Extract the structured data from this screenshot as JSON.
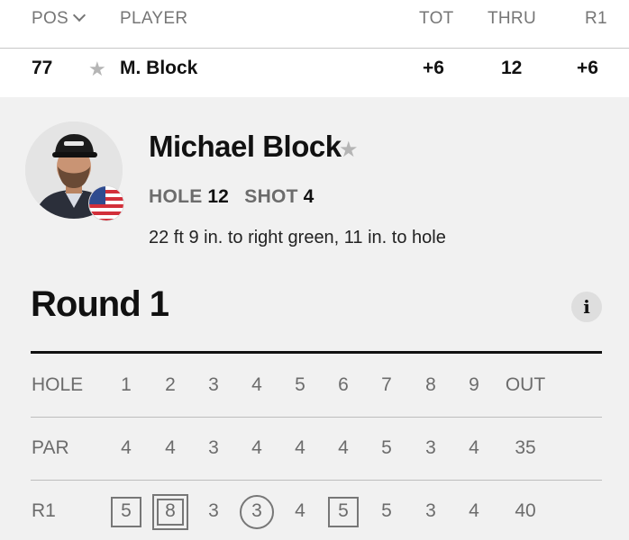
{
  "header": {
    "pos_label": "POS",
    "player_label": "PLAYER",
    "tot_label": "TOT",
    "thru_label": "THRU",
    "r1_label": "R1"
  },
  "player_row": {
    "pos": "77",
    "name": "M. Block",
    "tot": "+6",
    "thru": "12",
    "r1": "+6"
  },
  "player_detail": {
    "full_name": "Michael Block",
    "hole_label": "HOLE",
    "hole_value": "12",
    "shot_label": "SHOT",
    "shot_value": "4",
    "shot_description": "22 ft 9 in. to right green, 11 in. to hole",
    "country_flag": "usa-flag-icon"
  },
  "round": {
    "title": "Round 1",
    "info_label": "i"
  },
  "scorecard": {
    "rows": [
      {
        "label": "HOLE",
        "cells": [
          "1",
          "2",
          "3",
          "4",
          "5",
          "6",
          "7",
          "8",
          "9",
          "OUT"
        ]
      },
      {
        "label": "PAR",
        "cells": [
          "4",
          "4",
          "3",
          "4",
          "4",
          "4",
          "5",
          "3",
          "4",
          "35"
        ]
      },
      {
        "label": "R1",
        "cells": [
          "5",
          "8",
          "3",
          "3",
          "4",
          "5",
          "5",
          "3",
          "4",
          "40"
        ]
      }
    ],
    "r1_markers": [
      "bogey",
      "double-bogey-plus",
      "none",
      "birdie",
      "none",
      "bogey",
      "none",
      "none",
      "none",
      "none"
    ]
  },
  "colors": {
    "panel_bg": "#f1f1f1",
    "text_primary": "#111111",
    "text_muted": "#6c6c6c",
    "star_gray": "#b5b5b5"
  }
}
